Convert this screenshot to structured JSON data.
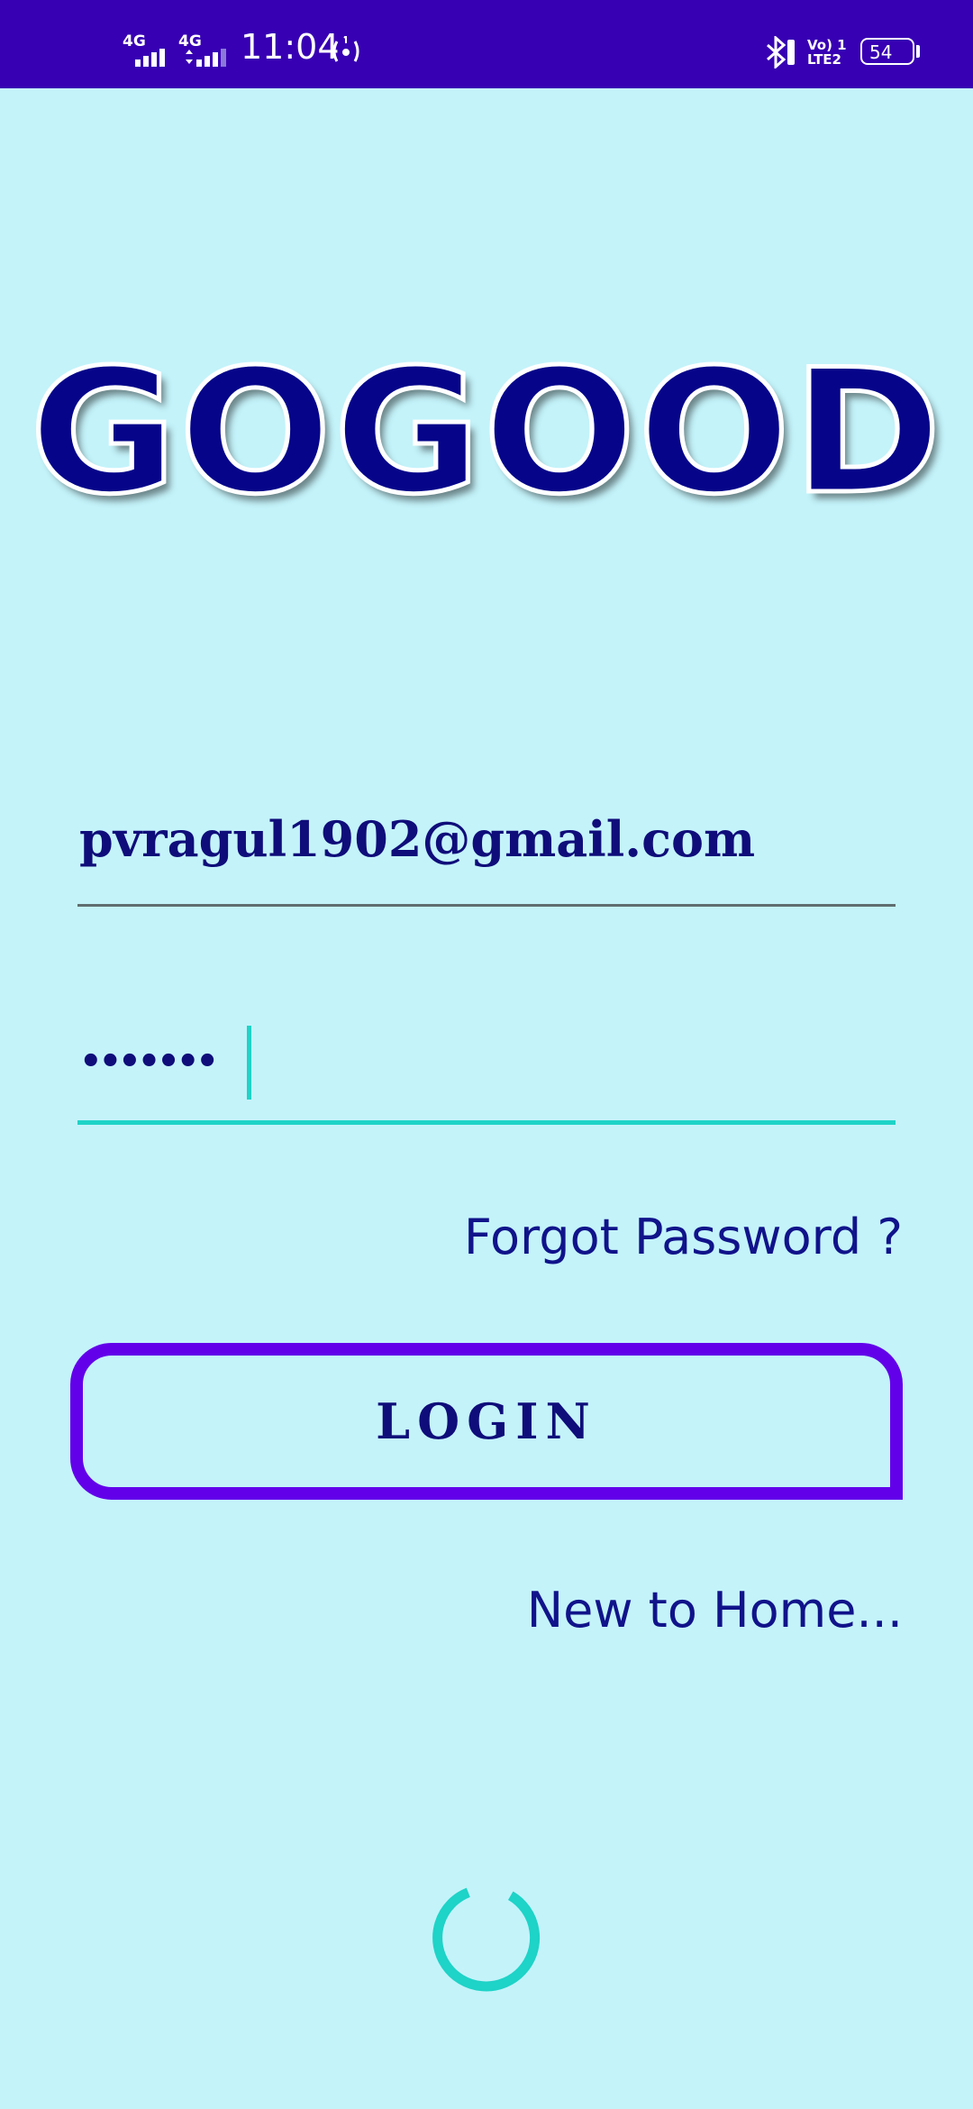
{
  "status_bar": {
    "network_1": "4G",
    "network_2": "4G",
    "time": "11:04",
    "volte_text": "Vo) 1\nLTE2",
    "battery_level": "54"
  },
  "logo": {
    "text": "GOGOOD"
  },
  "login_form": {
    "email_value": "pvragul1902@gmail.com",
    "password_value": "•••••••",
    "forgot_password_label": "Forgot Password ?",
    "login_button_label": "LOGIN",
    "new_to_home_label": "New to Home..."
  },
  "colors": {
    "background": "#c4f3fa",
    "status_bar": "#3700b3",
    "accent_purple": "#6200ea",
    "accent_teal": "#1ed3c7",
    "text_navy": "#0f0d7a"
  },
  "icons": {
    "spinner": "loading-spinner-icon"
  }
}
